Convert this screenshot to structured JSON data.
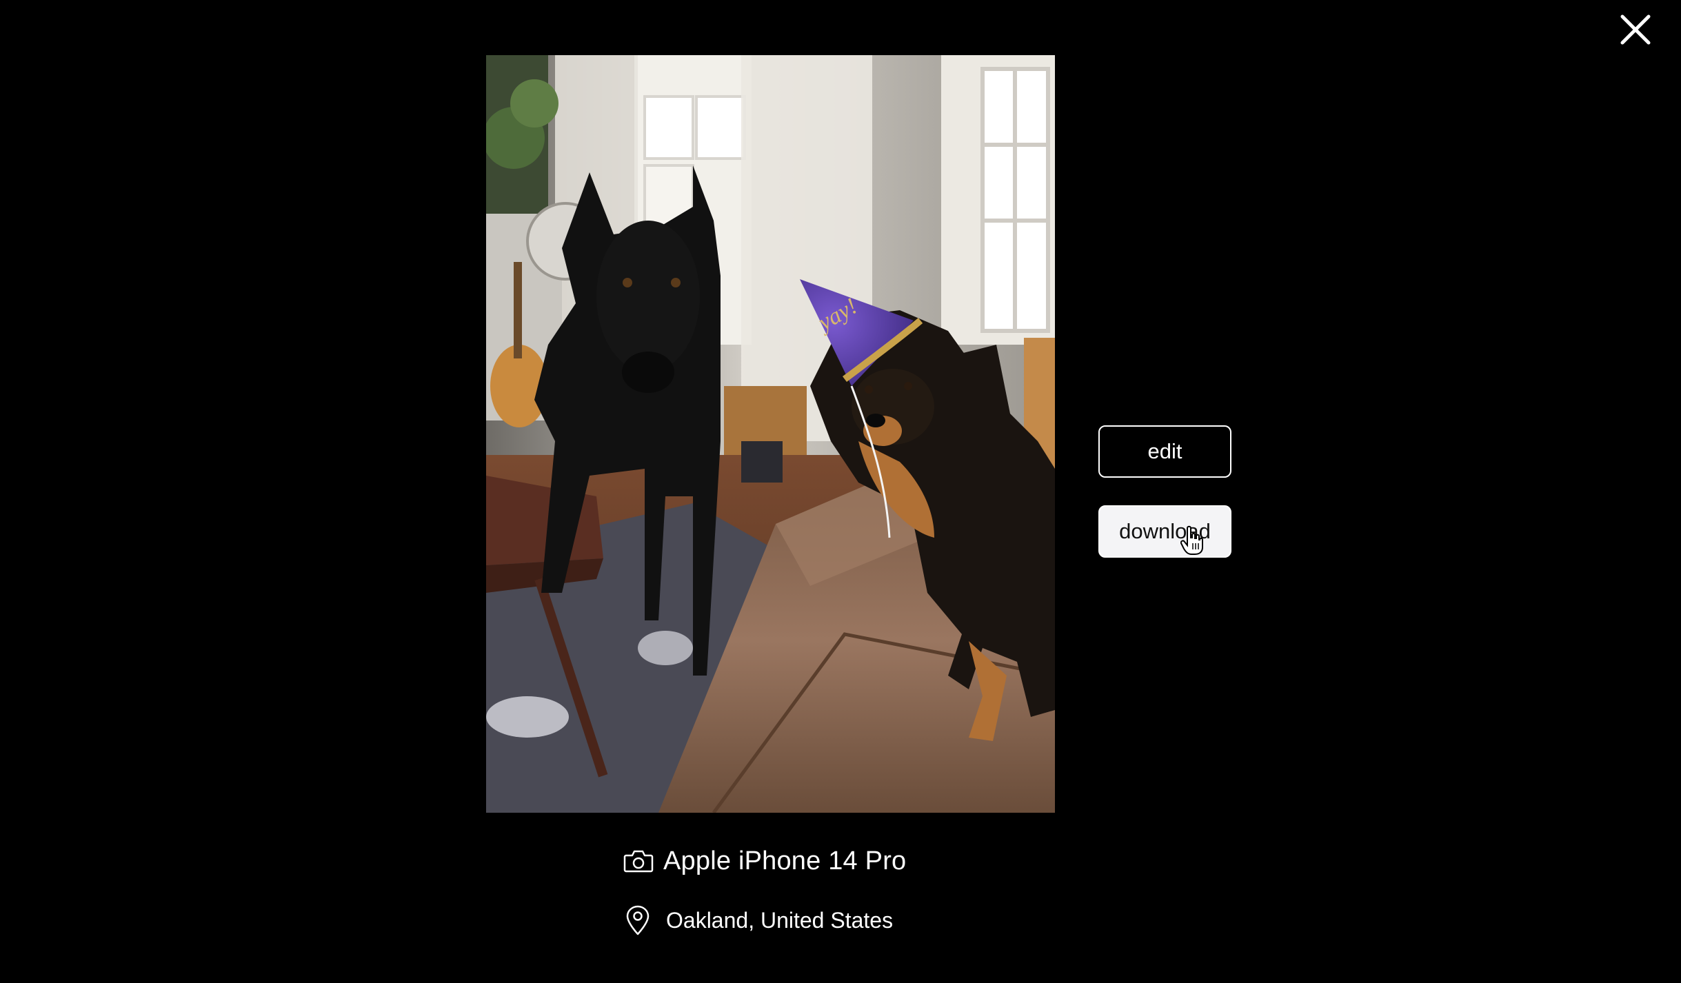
{
  "viewer": {
    "close_icon": "close-icon",
    "actions": {
      "edit_label": "edit",
      "download_label": "download"
    },
    "metadata": {
      "camera_icon": "camera-icon",
      "camera": "Apple iPhone 14 Pro",
      "location_icon": "map-pin-icon",
      "location": "Oakland, United States"
    },
    "photo": {
      "hat_text": "yay!"
    }
  },
  "colors": {
    "background": "#000000",
    "text": "#ffffff",
    "download_button_bg": "#f4f4f6",
    "hat_purple": "#5b3fa6",
    "hat_gold": "#c9a24a"
  }
}
